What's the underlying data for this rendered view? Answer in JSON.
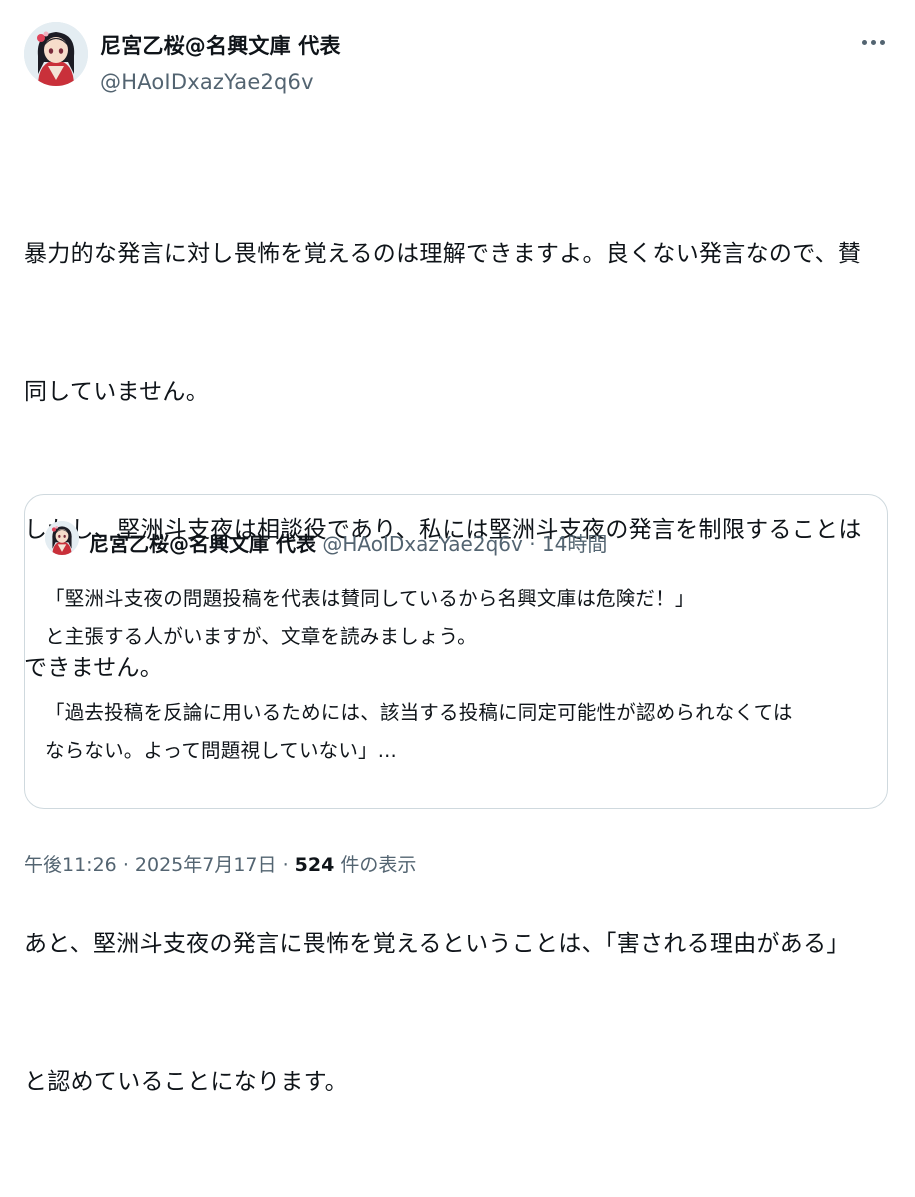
{
  "author": {
    "display_name": "尼宮乙桜@名興文庫 代表",
    "handle": "@HAoIDxazYae2q6v",
    "avatar_icon": "anime-character-avatar"
  },
  "menu": {
    "more_icon": "more-dots-icon"
  },
  "tweet": {
    "lines": [
      "暴力的な発言に対し畏怖を覚えるのは理解できますよ。良くない発言なので、賛",
      "同していません。",
      "しかし、堅洲斗支夜は相談役であり、私には堅洲斗支夜の発言を制限することは",
      "できません。",
      "",
      "あと、堅洲斗支夜の発言に畏怖を覚えるということは、「害される理由がある」",
      "と認めていることになります。"
    ]
  },
  "quote": {
    "display_name": "尼宮乙桜@名興文庫 代表",
    "handle": "@HAoIDxazYae2q6v",
    "separator": "·",
    "time": "14時間",
    "lines": [
      "「堅洲斗支夜の問題投稿を代表は賛同しているから名興文庫は危険だ！」",
      "と主張する人がいますが、文章を読みましょう。",
      "",
      "「過去投稿を反論に用いるためには、該当する投稿に同定可能性が認められなくては",
      "ならない。よって問題視していない」..."
    ]
  },
  "meta": {
    "time": "午後11:26",
    "separator1": "·",
    "date": "2025年7月17日",
    "separator2": "·",
    "view_count": "524",
    "view_label": "件の表示"
  }
}
